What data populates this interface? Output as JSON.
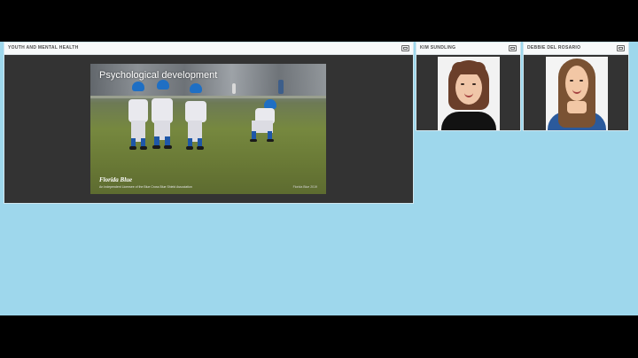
{
  "main_panel": {
    "title": "YOUTH AND MENTAL HEALTH",
    "slide": {
      "title": "Psychological development",
      "logo": "Florida Blue",
      "logo_subtext": "An Independent Licensee of the Blue Cross Blue Shield Association",
      "credit": "Florida Blue 2019"
    }
  },
  "participants": [
    {
      "name": "KIM SUNDLING"
    },
    {
      "name": "DEBBIE DEL ROSARIO"
    }
  ],
  "colors": {
    "stage_background": "#9ed7ec",
    "panel_body": "#333333",
    "helmet_blue": "#1f6fc4"
  },
  "icons": {
    "panel_control": "maximize-icon"
  }
}
